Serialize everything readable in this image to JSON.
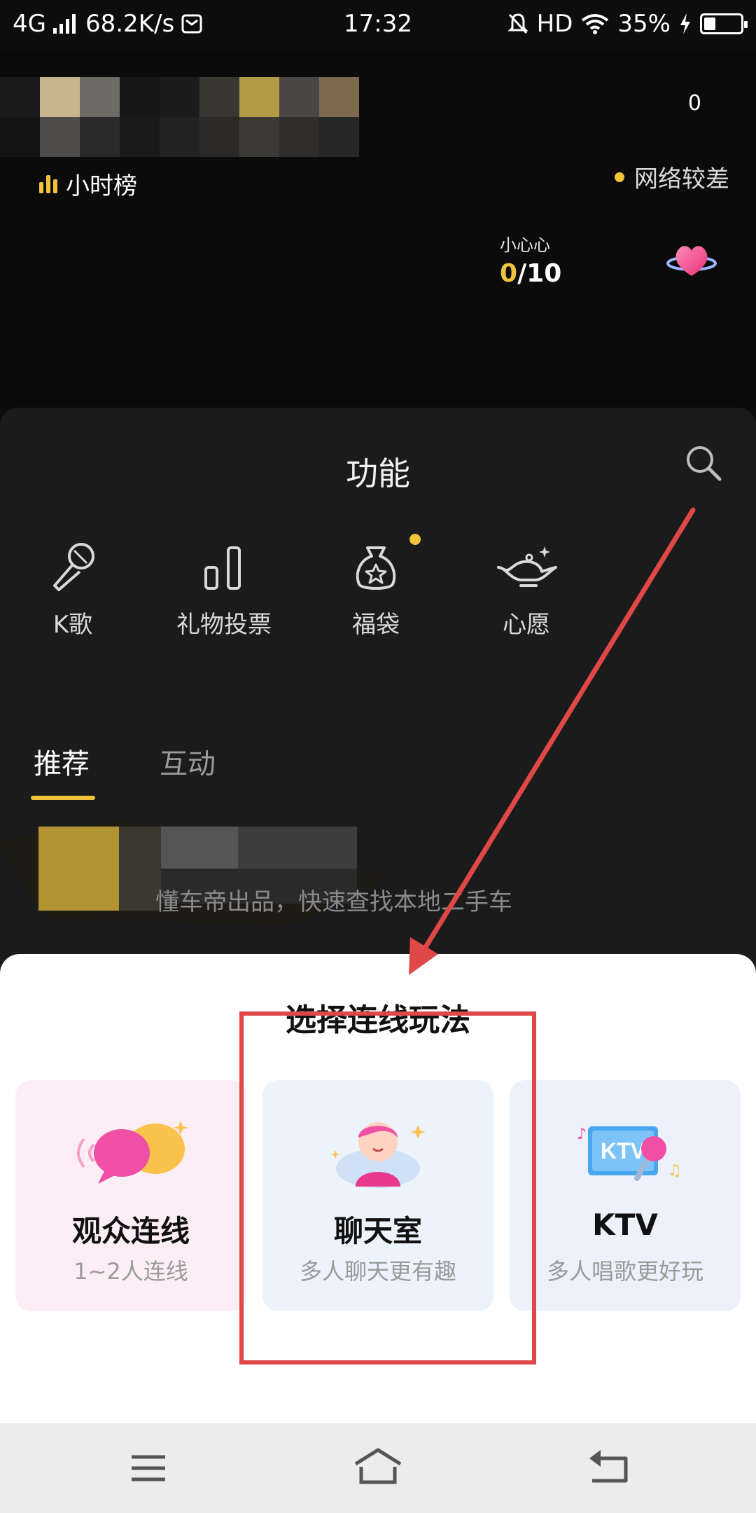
{
  "status_bar": {
    "network": "4G",
    "speed": "68.2K/s",
    "time": "17:32",
    "hd": "HD",
    "battery": "35%"
  },
  "live": {
    "viewer_count": "0",
    "rank_label": "小时榜",
    "network_status": "网络较差",
    "heart_label": "小心心",
    "heart_current": "0",
    "heart_total": "/10"
  },
  "panel": {
    "title": "功能",
    "functions": [
      {
        "label": "K歌",
        "icon": "microphone-icon"
      },
      {
        "label": "礼物投票",
        "icon": "bar-chart-icon"
      },
      {
        "label": "福袋",
        "icon": "lucky-bag-icon"
      },
      {
        "label": "心愿",
        "icon": "magic-lamp-icon"
      }
    ],
    "tabs": [
      {
        "label": "推荐",
        "active": true
      },
      {
        "label": "互动",
        "active": false
      }
    ],
    "promo_text": "懂车帝出品，快速查找本地二手车"
  },
  "sheet": {
    "title": "选择连线玩法",
    "cards": [
      {
        "title": "观众连线",
        "subtitle": "1~2人连线",
        "icon": "speech-bubbles-icon"
      },
      {
        "title": "聊天室",
        "subtitle": "多人聊天更有趣",
        "icon": "chat-person-icon"
      },
      {
        "title": "KTV",
        "subtitle": "多人唱歌更好玩",
        "icon": "ktv-screen-icon",
        "icon_text": "KTV"
      }
    ]
  },
  "colors": {
    "accent": "#f2c23a",
    "annotation": "#e04848",
    "sheet_bg": "#ffffff",
    "panel_bg": "#1b1b1b"
  }
}
